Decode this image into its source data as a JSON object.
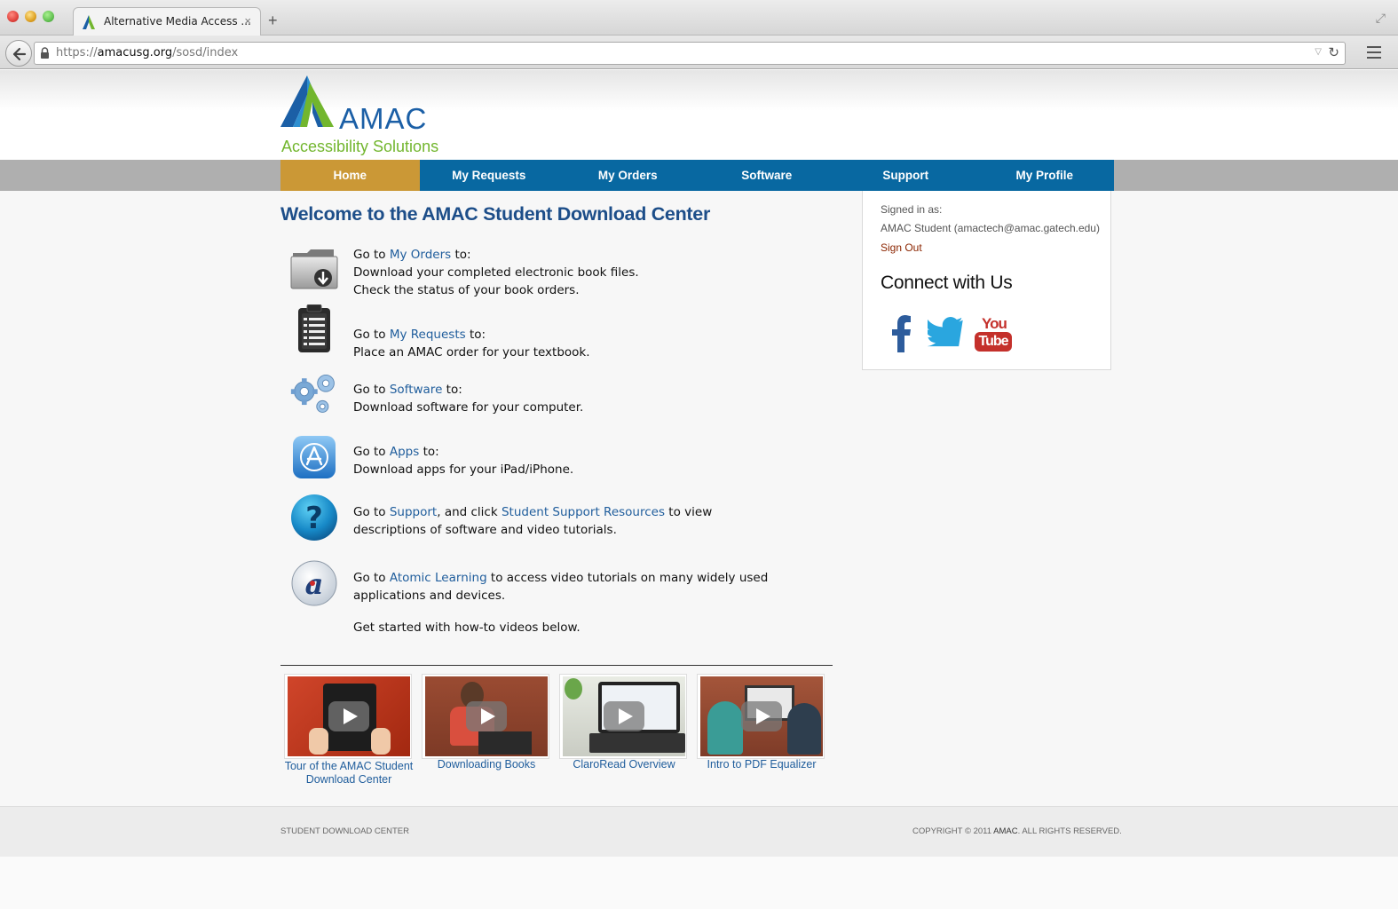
{
  "browser": {
    "tab_title": "Alternative Media Access ...",
    "tab_close": "×",
    "new_tab": "+",
    "url_scheme": "https://",
    "url_host": "amacusg.org",
    "url_path": "/sosd/index"
  },
  "logo": {
    "wordmark": "AMAC",
    "tagline": "Accessibility Solutions"
  },
  "nav": {
    "items": [
      "Home",
      "My Requests",
      "My Orders",
      "Software",
      "Support",
      "My Profile"
    ],
    "active": "Home"
  },
  "main": {
    "title": "Welcome to the AMAC Student Download Center",
    "items": [
      {
        "icon": "folder-download-icon",
        "pre": "Go to ",
        "link": "My Orders",
        "post": " to:",
        "lines": [
          "Download your completed electronic book files.",
          "Check the status of your book orders."
        ]
      },
      {
        "icon": "clipboard-icon",
        "pre": "Go to ",
        "link": "My Requests",
        "post": " to:",
        "lines": [
          "Place an AMAC order for your textbook."
        ]
      },
      {
        "icon": "gears-icon",
        "pre": "Go to ",
        "link": "Software",
        "post": " to:",
        "lines": [
          "Download software for your computer."
        ]
      },
      {
        "icon": "app-store-icon",
        "pre": "Go to ",
        "link": "Apps",
        "post": " to:",
        "lines": [
          "Download apps for your iPad/iPhone."
        ]
      },
      {
        "icon": "help-question-icon",
        "pre": "Go to ",
        "link": "Support",
        "mid": ", and click ",
        "link2": "Student Support Resources",
        "post": " to view",
        "lines": [
          "descriptions of software and video tutorials."
        ]
      },
      {
        "icon": "atomic-learning-icon",
        "pre": "Go to ",
        "link": "Atomic Learning",
        "post": " to access video tutorials on many widely used",
        "lines": [
          "applications and devices."
        ]
      }
    ],
    "get_started": "Get started with how-to videos below."
  },
  "videos": [
    {
      "title": "Tour of the AMAC Student Download Center"
    },
    {
      "title": "Downloading Books"
    },
    {
      "title": "ClaroRead Overview"
    },
    {
      "title": "Intro to PDF Equalizer"
    }
  ],
  "sidebar": {
    "signed_in_label": "Signed in as:",
    "user": "AMAC Student (amactech@amac.gatech.edu)",
    "sign_out": "Sign Out",
    "connect_title": "Connect with Us",
    "social": [
      "facebook-icon",
      "twitter-icon",
      "youtube-icon"
    ],
    "youtube_you": "You",
    "youtube_tube": "Tube"
  },
  "footer": {
    "left": "STUDENT DOWNLOAD CENTER",
    "copyright_pre": "COPYRIGHT © 2011 ",
    "copyright_brand": "AMAC",
    "copyright_post": ". ALL RIGHTS RESERVED."
  },
  "colors": {
    "nav_blue": "#0868a1",
    "nav_active": "#cb9836",
    "link": "#1f5d9c",
    "logo_blue": "#1b5fa6",
    "logo_green": "#72b62e"
  }
}
